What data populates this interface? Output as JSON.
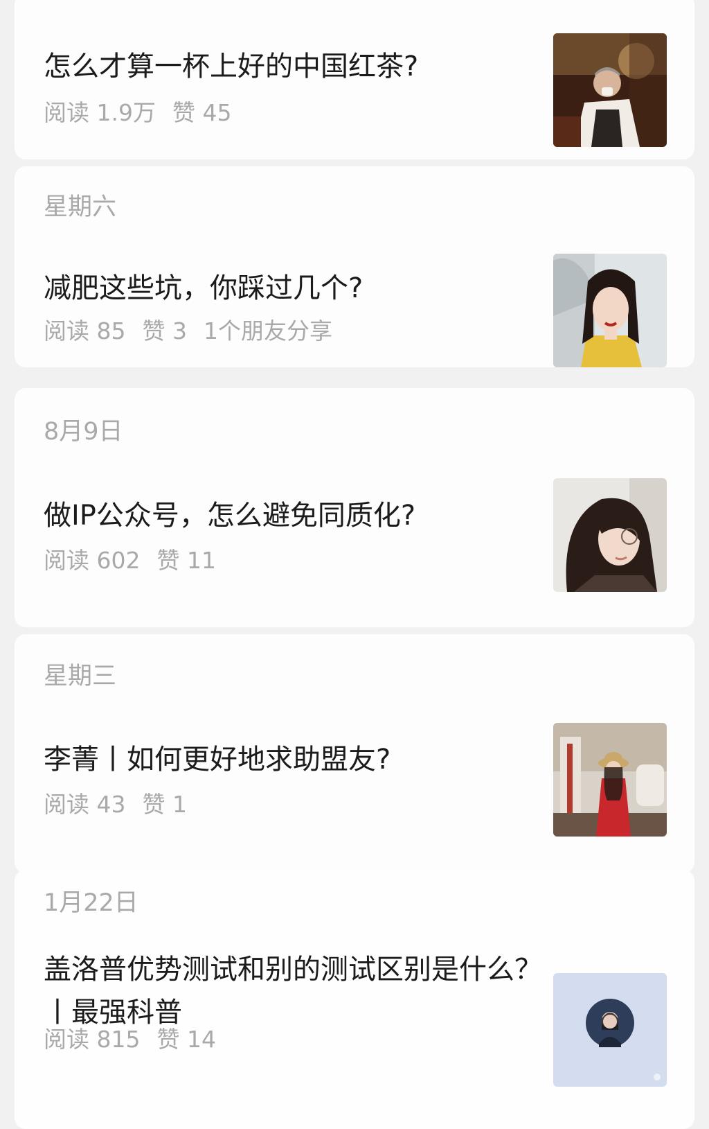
{
  "articles": [
    {
      "date": "",
      "title": "怎么才算一杯上好的中国红茶?",
      "reads": "阅读 1.9万",
      "likes": "赞 45",
      "shares": "",
      "thumbnail": "man-drinking-tea-photo"
    },
    {
      "date": "星期六",
      "title": "减肥这些坑，你踩过几个?",
      "reads": "阅读 85",
      "likes": "赞 3",
      "shares": "1个朋友分享",
      "thumbnail": "woman-portrait-yellow-photo"
    },
    {
      "date": "8月9日",
      "title": "做IP公众号，怎么避免同质化?",
      "reads": "阅读 602",
      "likes": "赞 11",
      "shares": "",
      "thumbnail": "woman-glasses-portrait-photo"
    },
    {
      "date": "星期三",
      "title": "李菁丨如何更好地求助盟友?",
      "reads": "阅读 43",
      "likes": "赞 1",
      "shares": "",
      "thumbnail": "woman-red-dress-hat-photo"
    },
    {
      "date": "1月22日",
      "title": "盖洛普优势测试和别的测试区别是什么？ 丨最强科普",
      "reads": "阅读 815",
      "likes": "赞 14",
      "shares": "",
      "thumbnail": "avatar-circle-on-blue-photo"
    }
  ]
}
